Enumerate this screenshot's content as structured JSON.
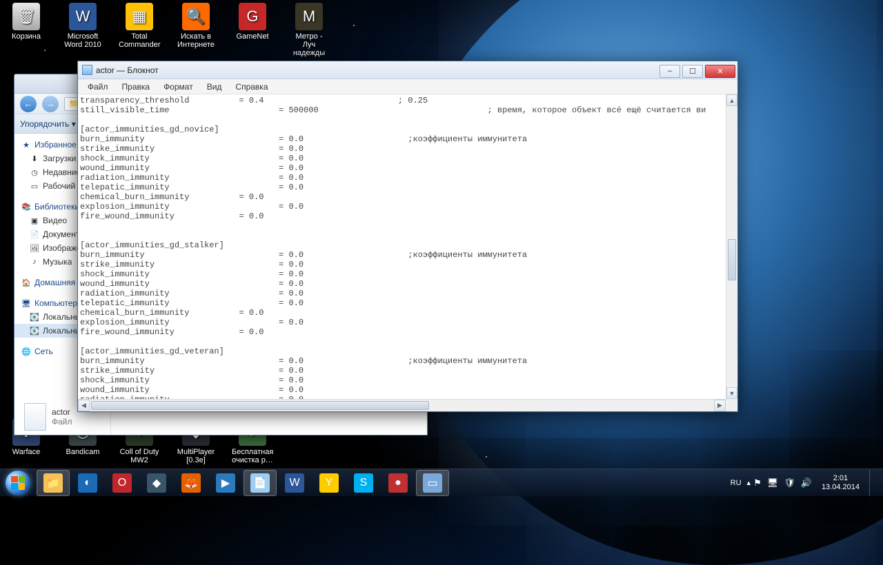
{
  "desktop_icons_top": [
    {
      "label": "Корзина",
      "bg": "linear-gradient(#e8e8e8,#a8a8a8)",
      "glyph": "🗑"
    },
    {
      "label": "Microsoft Word 2010",
      "bg": "#2b579a",
      "glyph": "W"
    },
    {
      "label": "Total Commander",
      "bg": "#ffc107",
      "glyph": "▦"
    },
    {
      "label": "Искать в Интернете",
      "bg": "#ff6a00",
      "glyph": "🔍"
    },
    {
      "label": "GameNet",
      "bg": "#c62828",
      "glyph": "G"
    },
    {
      "label": "Метро - Луч надежды",
      "bg": "#3a3626",
      "glyph": "M"
    }
  ],
  "desktop_icons_bottom": [
    {
      "label": "Warface",
      "bg": "#304674",
      "glyph": "✱"
    },
    {
      "label": "Bandicam",
      "bg": "#3a484a",
      "glyph": "◎"
    },
    {
      "label": "Coll of Duty MW2",
      "bg": "#2a3a24",
      "glyph": "●"
    },
    {
      "label": "MultiPlayer [0.3е]",
      "bg": "#2a2a34",
      "glyph": "◆"
    },
    {
      "label": "Бесплатная очистка р…",
      "bg": "#3a6a3a",
      "glyph": "⟳"
    }
  ],
  "explorer": {
    "win_buttons": {
      "min": "–",
      "max": "☐",
      "close": "x"
    },
    "addr_prefix": "« ",
    "organize": "Упорядочить ▾",
    "sections": [
      {
        "title": "Избранное",
        "icon": "★",
        "items": [
          {
            "label": "Загрузки",
            "icon": "⬇"
          },
          {
            "label": "Недавние м",
            "icon": "◷"
          },
          {
            "label": "Рабочий ст",
            "icon": "▭"
          }
        ]
      },
      {
        "title": "Библиотеки",
        "icon": "📚",
        "items": [
          {
            "label": "Видео",
            "icon": "▣"
          },
          {
            "label": "Документы",
            "icon": "📄"
          },
          {
            "label": "Изображени",
            "icon": "🖼"
          },
          {
            "label": "Музыка",
            "icon": "♪"
          }
        ]
      },
      {
        "title": "Домашняя гр",
        "icon": "🏠",
        "items": []
      },
      {
        "title": "Компьютер",
        "icon": "🖥",
        "items": [
          {
            "label": "Локальный",
            "icon": "💽"
          },
          {
            "label": "Локальный",
            "icon": "💽",
            "sel": true
          }
        ]
      },
      {
        "title": "Сеть",
        "icon": "🌐",
        "items": []
      }
    ],
    "file": {
      "name": "actor",
      "type": "Файл"
    }
  },
  "notepad": {
    "title": "actor — Блокнот",
    "menus": [
      "Файл",
      "Правка",
      "Формат",
      "Вид",
      "Справка"
    ],
    "win_buttons": {
      "min": "–",
      "max": "☐",
      "close": "✕"
    },
    "content": "transparency_threshold          = 0.4                           ; 0.25\nstill_visible_time                      = 500000                                  ; время, которое объект всё ещё считается ви\n\n[actor_immunities_gd_novice]\nburn_immunity                           = 0.0                     ;коэффициенты иммунитета\nstrike_immunity                         = 0.0\nshock_immunity                          = 0.0\nwound_immunity                          = 0.0\nradiation_immunity                      = 0.0\ntelepatic_immunity                      = 0.0\nchemical_burn_immunity          = 0.0\nexplosion_immunity                      = 0.0\nfire_wound_immunity             = 0.0\n\n\n[actor_immunities_gd_stalker]\nburn_immunity                           = 0.0                     ;коэффициенты иммунитета\nstrike_immunity                         = 0.0\nshock_immunity                          = 0.0\nwound_immunity                          = 0.0\nradiation_immunity                      = 0.0\ntelepatic_immunity                      = 0.0\nchemical_burn_immunity          = 0.0\nexplosion_immunity                      = 0.0\nfire_wound_immunity             = 0.0\n\n[actor_immunities_gd_veteran]\nburn_immunity                           = 0.0                     ;коэффициенты иммунитета\nstrike_immunity                         = 0.0\nshock_immunity                          = 0.0\nwound_immunity                          = 0.0\nradiation_immunity                      = 0.0\ntelepatic_immunity                      = 0.0\nchemical_burn_immunity          = 0.0"
  },
  "taskbar": {
    "items": [
      {
        "name": "explorer",
        "bg": "#f6c258",
        "glyph": "📁",
        "active": true
      },
      {
        "name": "wmp",
        "bg": "#1a6ab8",
        "glyph": "◐"
      },
      {
        "name": "opera",
        "bg": "#c1262c",
        "glyph": "O"
      },
      {
        "name": "app1",
        "bg": "#3a546a",
        "glyph": "◆"
      },
      {
        "name": "firefox",
        "bg": "#e66000",
        "glyph": "🦊"
      },
      {
        "name": "kmp",
        "bg": "#2a7abc",
        "glyph": "▶"
      },
      {
        "name": "notepad",
        "bg": "#9fcef2",
        "glyph": "📄",
        "active": true
      },
      {
        "name": "word",
        "bg": "#2b579a",
        "glyph": "W"
      },
      {
        "name": "yandex",
        "bg": "#ffcc00",
        "glyph": "Y"
      },
      {
        "name": "skype",
        "bg": "#00aff0",
        "glyph": "S"
      },
      {
        "name": "bandicam",
        "bg": "#c03030",
        "glyph": "●"
      },
      {
        "name": "app2",
        "bg": "#7aa8d8",
        "glyph": "▭",
        "active": true
      }
    ],
    "lang": "RU",
    "tray_up": "▴",
    "tray_icons": [
      "⚑",
      "🖥",
      "🛡",
      "🔊"
    ],
    "time": "2:01",
    "date": "13.04.2014"
  }
}
